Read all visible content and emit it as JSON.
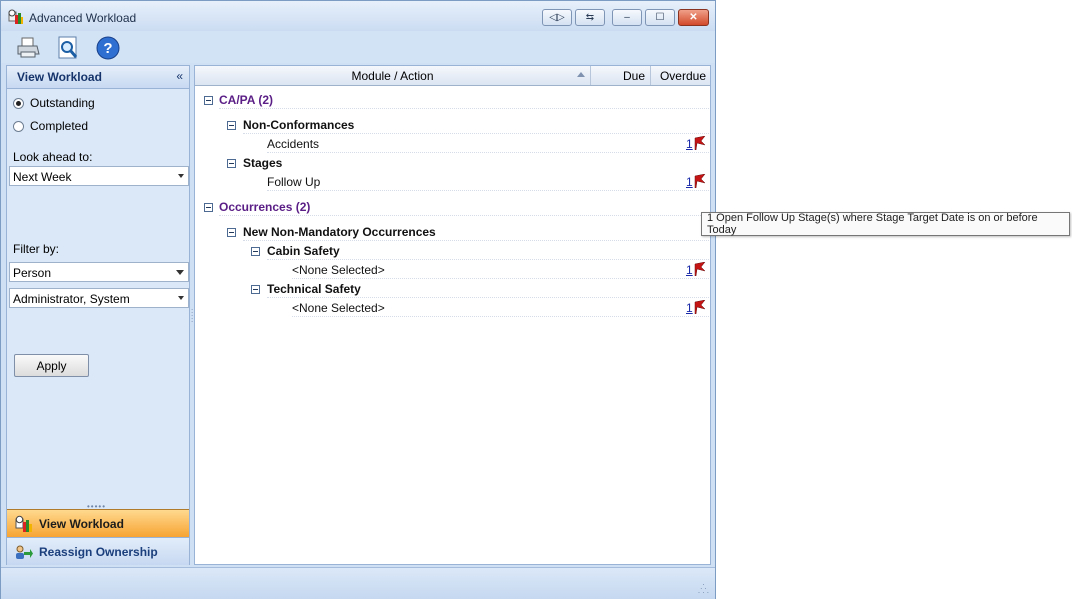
{
  "window": {
    "title": "Advanced Workload",
    "buttons": {
      "restore_layout": "◁▷",
      "export": "⇆",
      "minimize": "–",
      "maximize": "☐",
      "close": "✕"
    }
  },
  "toolbar": {
    "icons": [
      "printer-icon",
      "preview-icon",
      "help-icon"
    ]
  },
  "left_pane": {
    "title": "View Workload",
    "collapse_glyph": "«",
    "status_options": [
      {
        "label": "Outstanding",
        "selected": true
      },
      {
        "label": "Completed",
        "selected": false
      }
    ],
    "look_ahead_label": "Look ahead to:",
    "look_ahead_value": "Next Week",
    "filter_label": "Filter by:",
    "filter_type_value": "Person",
    "filter_person_value": "Administrator, System",
    "apply_label": "Apply",
    "grip": "•••••"
  },
  "nav": {
    "view_workload": "View Workload",
    "reassign_ownership": "Reassign Ownership"
  },
  "grid": {
    "columns": {
      "module_action": "Module / Action",
      "due": "Due",
      "overdue": "Overdue"
    },
    "rows": [
      {
        "label": "CA/PA (2)",
        "overdue": ""
      },
      {
        "label": "Non-Conformances",
        "overdue": ""
      },
      {
        "label": "Accidents",
        "overdue": "1"
      },
      {
        "label": "Stages",
        "overdue": ""
      },
      {
        "label": "Follow Up",
        "overdue": "1"
      },
      {
        "label": "Occurrences (2)",
        "overdue": ""
      },
      {
        "label": "New Non-Mandatory Occurrences",
        "overdue": ""
      },
      {
        "label": "Cabin Safety",
        "overdue": ""
      },
      {
        "label": "<None Selected>",
        "overdue": "1"
      },
      {
        "label": "Technical Safety",
        "overdue": ""
      },
      {
        "label": "<None Selected>",
        "overdue": "1"
      }
    ]
  },
  "tooltip": "1 Open Follow Up Stage(s) where Stage Target Date is on or before Today",
  "colors": {
    "group_heading": "#5a1e86",
    "flag": "#c41414",
    "active_nav": "#f7a433"
  }
}
